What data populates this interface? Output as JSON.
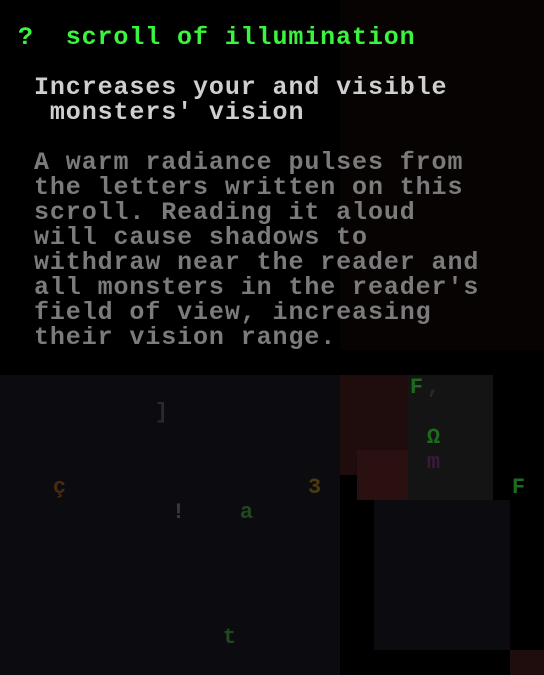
{
  "item": {
    "glyph": "?",
    "name": "scroll of illumination",
    "summary_lines": [
      "Increases your and visible",
      " monsters' vision"
    ],
    "description_lines": [
      "A warm radiance pulses from",
      "the letters written on this",
      "scroll. Reading it aloud",
      "will cause shadows to",
      "withdraw near the reader and",
      "all monsters in the reader's",
      "field of view, increasing",
      "their vision range."
    ]
  },
  "map_glyphs": [
    {
      "ch": "F",
      "color": "#1e6a1e"
    },
    {
      "ch": ",",
      "color": "#2a2a2a"
    },
    {
      "ch": "Ω",
      "color": "#1e6a1e"
    },
    {
      "ch": "m",
      "color": "#3a1a3a"
    },
    {
      "ch": "F",
      "color": "#1e6a1e"
    },
    {
      "ch": "ç",
      "color": "#4a2a10"
    },
    {
      "ch": "3",
      "color": "#4a3a10"
    },
    {
      "ch": "!",
      "color": "#3a3a3a"
    },
    {
      "ch": "a",
      "color": "#1e4a1e"
    },
    {
      "ch": "t",
      "color": "#1e4a1e"
    },
    {
      "ch": "]",
      "color": "#2a2a2a"
    }
  ],
  "colors": {
    "title": "#39f53d",
    "summary": "#cfcfcf",
    "description": "#7b7b7b",
    "background": "#000000"
  }
}
